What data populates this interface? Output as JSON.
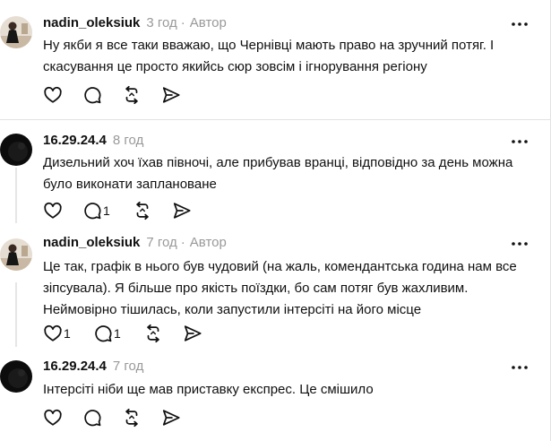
{
  "comments": [
    {
      "username": "nadin_oleksiuk",
      "time": "3 год",
      "separator": "·",
      "author_badge": "Автор",
      "text": "Ну якби я все таки вважаю, що Чернівці мають право на зручний потяг. І скасування це просто якийсь сюр зовсім і ігнорування регіону",
      "like_count": "",
      "reply_count": "",
      "avatar": "woman-in-black-dress-photo"
    },
    {
      "username": "16.29.24.4",
      "time": "8 год",
      "separator": "",
      "author_badge": "",
      "text": "Дизельний хоч їхав півночі, але прибував вранці, відповідно за день можна було виконати заплановане",
      "like_count": "",
      "reply_count": "1",
      "avatar": "dark-photo"
    },
    {
      "username": "nadin_oleksiuk",
      "time": "7 год",
      "separator": "·",
      "author_badge": "Автор",
      "text": "Це так, графік в нього був чудовий (на жаль, комендантська година нам все зіпсувала). Я більше про якість поїздки, бо сам потяг був жахливим. Неймовірно тішилась, коли запустили інтерсіті на його місце",
      "like_count": "1",
      "reply_count": "1",
      "avatar": "woman-in-black-dress-photo"
    },
    {
      "username": "16.29.24.4",
      "time": "7 год",
      "separator": "",
      "author_badge": "",
      "text": "Інтерсіті ніби ще мав приставку експрес. Це смішило",
      "like_count": "",
      "reply_count": "",
      "avatar": "dark-photo"
    }
  ],
  "icons": {
    "like": "heart-icon",
    "reply": "speech-bubble-icon",
    "repost": "repost-arrows-icon",
    "share": "paper-plane-icon",
    "more": "more-dots-icon"
  }
}
